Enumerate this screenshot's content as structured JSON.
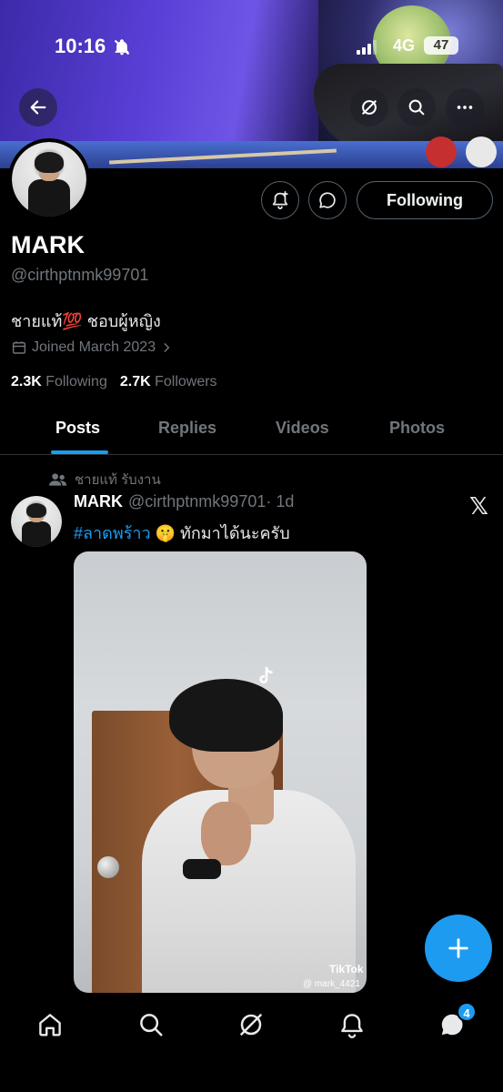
{
  "status_bar": {
    "time": "10:16",
    "network": "4G",
    "battery": "47"
  },
  "profile": {
    "name": "MARK",
    "handle": "@cirthptnmk99701",
    "bio": "ชายแท้💯 ชอบผู้หญิง",
    "joined": "Joined March 2023",
    "following_count": "2.3K",
    "following_label": "Following",
    "followers_count": "2.7K",
    "followers_label": "Followers",
    "follow_button": "Following"
  },
  "tabs": [
    {
      "label": "Posts",
      "active": true
    },
    {
      "label": "Replies",
      "active": false
    },
    {
      "label": "Videos",
      "active": false
    },
    {
      "label": "Photos",
      "active": false
    }
  ],
  "post": {
    "repost_context": "ชายแท้ รับงาน",
    "author_name": "MARK",
    "author_handle": "@cirthptnmk99701",
    "time": "· 1d",
    "hashtag": "#ลาดพร้าว",
    "emoji": "🤫",
    "text": "ทักมาได้นะครับ",
    "media_watermark": "TikTok",
    "media_user": "@ mark_4421"
  },
  "nav": {
    "messages_badge": "4"
  },
  "icons": {
    "back": "arrow-left-icon",
    "grok": "grok-icon",
    "search": "search-icon",
    "more": "more-icon",
    "notify": "bell-plus-icon",
    "message": "message-bubble-icon",
    "calendar": "calendar-icon",
    "x": "x-logo-icon",
    "compose": "plus-icon"
  },
  "colors": {
    "accent": "#1d9bf0",
    "background": "#000000",
    "secondary_text": "#71767b"
  }
}
